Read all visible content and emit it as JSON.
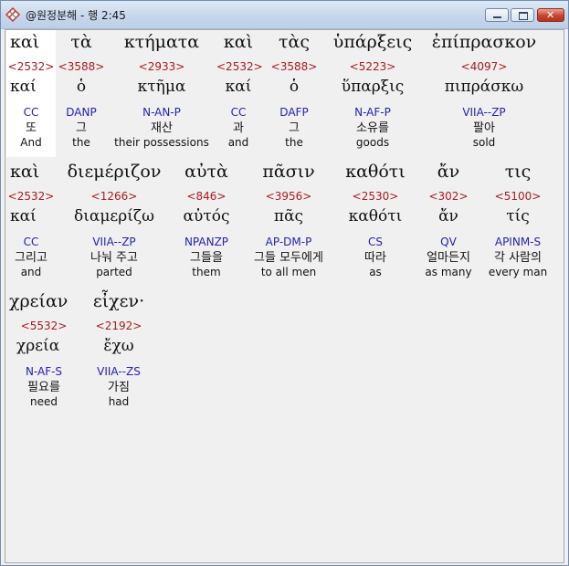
{
  "window": {
    "title": "@원정분해 - 행 2:45",
    "icon": "scripture-parse-app-icon",
    "controls": {
      "minimize": "minimize",
      "maximize": "maximize",
      "close": "✕"
    }
  },
  "rows": [
    {
      "words": [
        {
          "greek": "καὶ",
          "strong": "<2532>",
          "lemma": "καί",
          "parse": "CC",
          "korean": "또",
          "english": "And"
        },
        {
          "greek": "τὰ",
          "strong": "<3588>",
          "lemma": "ὁ",
          "parse": "DANP",
          "korean": "그",
          "english": "the"
        },
        {
          "greek": "κτήματα",
          "strong": "<2933>",
          "lemma": "κτῆμα",
          "parse": "N-AN-P",
          "korean": "재산",
          "english": "their possessions"
        },
        {
          "greek": "καὶ",
          "strong": "<2532>",
          "lemma": "καί",
          "parse": "CC",
          "korean": "과",
          "english": "and"
        },
        {
          "greek": "τὰς",
          "strong": "<3588>",
          "lemma": "ὁ",
          "parse": "DAFP",
          "korean": "그",
          "english": "the"
        },
        {
          "greek": "ὑπάρξεις",
          "strong": "<5223>",
          "lemma": "ὕπαρξις",
          "parse": "N-AF-P",
          "korean": "소유를",
          "english": "goods"
        },
        {
          "greek": "ἐπίπρασκον",
          "strong": "<4097>",
          "lemma": "πιπράσκω",
          "parse": "VIIA--ZP",
          "korean": "팔아",
          "english": "sold"
        }
      ]
    },
    {
      "words": [
        {
          "greek": "καὶ",
          "strong": "<2532>",
          "lemma": "καί",
          "parse": "CC",
          "korean": "그리고",
          "english": "and"
        },
        {
          "greek": "διεμέριζον",
          "strong": "<1266>",
          "lemma": "διαμερίζω",
          "parse": "VIIA--ZP",
          "korean": "나눠 주고",
          "english": "parted"
        },
        {
          "greek": "αὐτὰ",
          "strong": "<846>",
          "lemma": "αὐτός",
          "parse": "NPANZP",
          "korean": "그들을",
          "english": "them"
        },
        {
          "greek": "πᾶσιν",
          "strong": "<3956>",
          "lemma": "πᾶς",
          "parse": "AP-DM-P",
          "korean": "그들 모두에게",
          "english": "to all men"
        },
        {
          "greek": "καθότι",
          "strong": "<2530>",
          "lemma": "καθότι",
          "parse": "CS",
          "korean": "따라",
          "english": "as"
        },
        {
          "greek": "ἄν",
          "strong": "<302>",
          "lemma": "ἄν",
          "parse": "QV",
          "korean": "얼마든지",
          "english": "as many"
        },
        {
          "greek": "τις",
          "strong": "<5100>",
          "lemma": "τίς",
          "parse": "APINM-S",
          "korean": "각 사람의",
          "english": "every man"
        }
      ]
    },
    {
      "words": [
        {
          "greek": "χρείαν",
          "strong": "<5532>",
          "lemma": "χρεία",
          "parse": "N-AF-S",
          "korean": "필요를",
          "english": "need"
        },
        {
          "greek": "εἶχεν·",
          "strong": "<2192>",
          "lemma": "ἔχω",
          "parse": "VIIA--ZS",
          "korean": "가짐",
          "english": "had"
        }
      ]
    }
  ]
}
